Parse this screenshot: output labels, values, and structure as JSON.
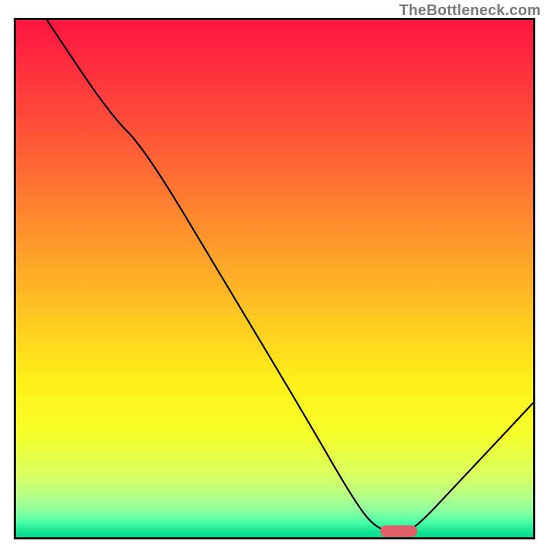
{
  "watermark": "TheBottleneck.com",
  "colors": {
    "border": "#000000",
    "curve": "#000000",
    "marker": "#de6168",
    "watermark": "#797979"
  },
  "chart_data": {
    "type": "line",
    "title": "",
    "xlabel": "",
    "ylabel": "",
    "xlim": [
      0,
      100
    ],
    "ylim": [
      0,
      100
    ],
    "curve_points": [
      {
        "x": 6,
        "y": 100
      },
      {
        "x": 18,
        "y": 82
      },
      {
        "x": 25,
        "y": 75
      },
      {
        "x": 40,
        "y": 50
      },
      {
        "x": 55,
        "y": 25
      },
      {
        "x": 66,
        "y": 6
      },
      {
        "x": 70,
        "y": 1.5
      },
      {
        "x": 74,
        "y": 1
      },
      {
        "x": 77,
        "y": 1.5
      },
      {
        "x": 85,
        "y": 10
      },
      {
        "x": 100,
        "y": 26
      }
    ],
    "minimum_marker": {
      "x": 74,
      "y": 1.2
    },
    "gradient_stops": [
      {
        "pct": 0,
        "color": "#ff163e"
      },
      {
        "pct": 8,
        "color": "#ff2b40"
      },
      {
        "pct": 25,
        "color": "#ff5d37"
      },
      {
        "pct": 40,
        "color": "#ff8f2e"
      },
      {
        "pct": 55,
        "color": "#ffc024"
      },
      {
        "pct": 70,
        "color": "#fff01a"
      },
      {
        "pct": 80,
        "color": "#f6ff2a"
      },
      {
        "pct": 88,
        "color": "#d8ff61"
      },
      {
        "pct": 92,
        "color": "#b7ff88"
      },
      {
        "pct": 95,
        "color": "#88ffa0"
      },
      {
        "pct": 97,
        "color": "#4dffa8"
      },
      {
        "pct": 99,
        "color": "#11e190"
      },
      {
        "pct": 100,
        "color": "#0fd98c"
      }
    ]
  }
}
